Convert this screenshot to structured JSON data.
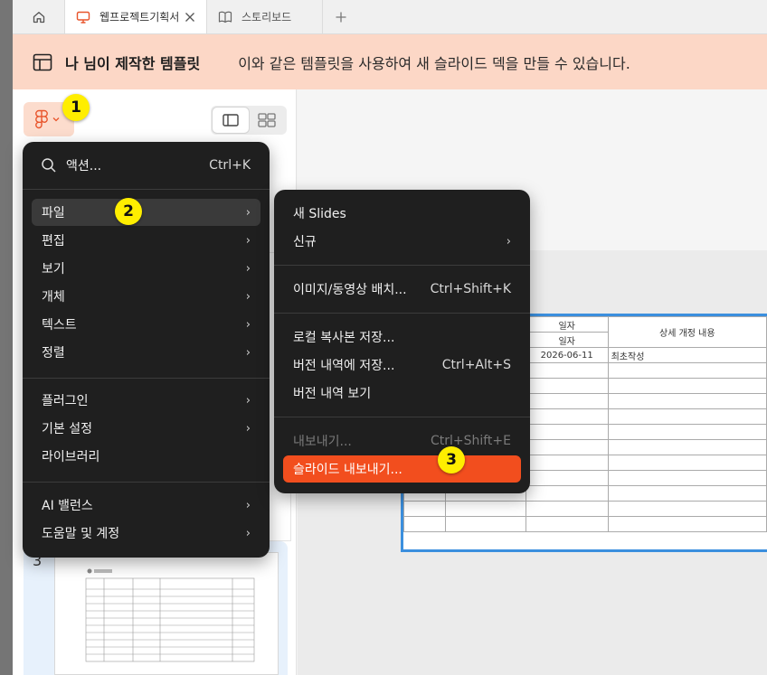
{
  "tabs": [
    {
      "label": "웹프로젝트기획서",
      "icon": "slides-icon",
      "active": true
    },
    {
      "label": "스토리보드",
      "icon": "book-icon",
      "active": false
    }
  ],
  "banner": {
    "title": "나 님이 제작한 템플릿",
    "description": "이와 같은 템플릿을 사용하여 새 슬라이드 덱을 만들 수 있습니다."
  },
  "main_menu": {
    "search": {
      "label": "액션...",
      "shortcut": "Ctrl+K"
    },
    "items": [
      {
        "label": "파일",
        "submenu": true
      },
      {
        "label": "편집",
        "submenu": true
      },
      {
        "label": "보기",
        "submenu": true
      },
      {
        "label": "개체",
        "submenu": true
      },
      {
        "label": "텍스트",
        "submenu": true
      },
      {
        "label": "정렬",
        "submenu": true
      },
      {
        "label": "플러그인",
        "submenu": true
      },
      {
        "label": "기본 설정",
        "submenu": true
      },
      {
        "label": "라이브러리",
        "submenu": false
      },
      {
        "label": "AI 밸런스",
        "submenu": true
      },
      {
        "label": "도움말 및 계정",
        "submenu": true
      }
    ]
  },
  "file_menu": {
    "items": [
      {
        "label": "새 Slides",
        "shortcut": ""
      },
      {
        "label": "신규",
        "shortcut": ""
      },
      {
        "label": "이미지/동영상 배치...",
        "shortcut": "Ctrl+Shift+K"
      },
      {
        "label": "로컬 복사본 저장...",
        "shortcut": ""
      },
      {
        "label": "버전 내역에 저장...",
        "shortcut": "Ctrl+Alt+S"
      },
      {
        "label": "버전 내역 보기",
        "shortcut": ""
      },
      {
        "label": "내보내기...",
        "shortcut": "Ctrl+Shift+E"
      },
      {
        "label": "슬라이드 내보내기...",
        "shortcut": ""
      }
    ]
  },
  "badges": [
    "1",
    "2",
    "3"
  ],
  "slide_table": {
    "header_date": "일자",
    "header_date2": "일자",
    "header_detail": "상세 개정 내용",
    "row1_date": "2026-06-11",
    "row1_detail": "최초작성"
  },
  "thumbnail": {
    "number": "3"
  },
  "colors": {
    "accent": "#f24e1e",
    "banner_bg": "#fcd7c6",
    "menu_bg": "#1f1f1f",
    "badge": "#ffee00",
    "selection": "#3b8fde"
  }
}
